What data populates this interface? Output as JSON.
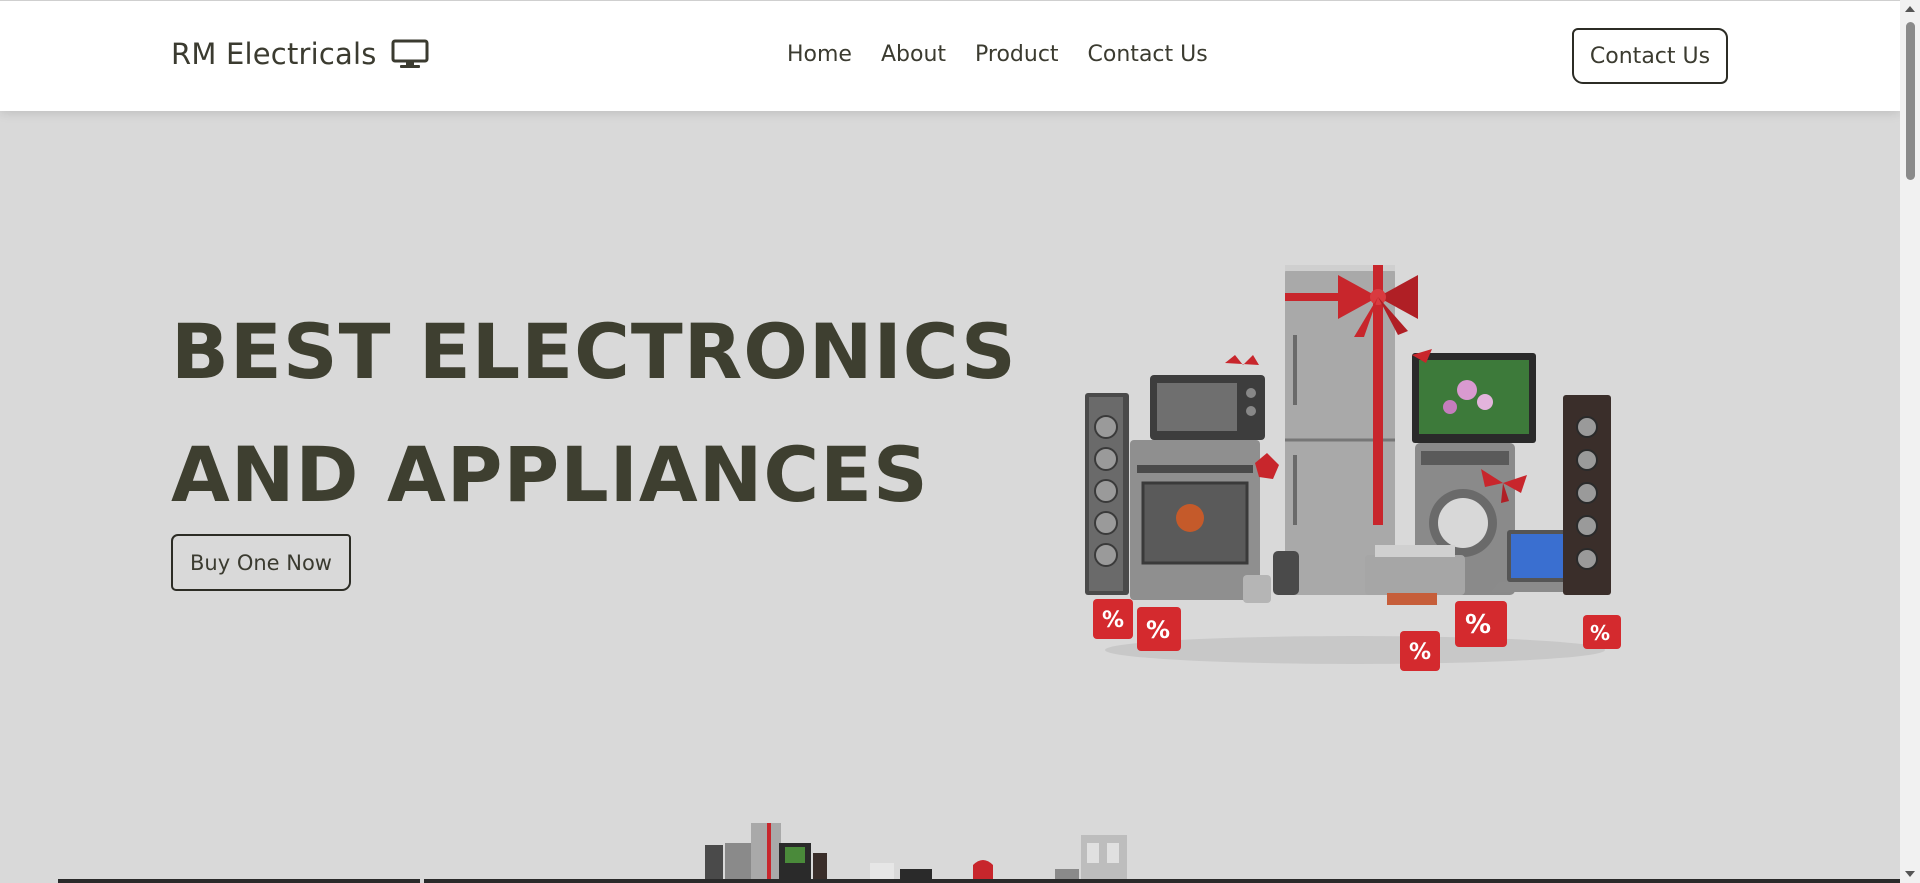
{
  "header": {
    "brand": "RM Electricals",
    "brand_icon": "monitor-icon",
    "nav": [
      "Home",
      "About",
      "Product",
      "Contact Us"
    ],
    "cta_label": "Contact Us"
  },
  "hero": {
    "headline_line1": "BEST ELECTRONICS",
    "headline_line2": "AND APPLIANCES",
    "cta_label": "Buy One Now",
    "image": "home-appliances-gift-image",
    "strip_image": "appliances-thumbnail-strip"
  },
  "colors": {
    "background": "#d9d9d9",
    "header_bg": "#ffffff",
    "text": "#3e3f30",
    "accent_red": "#c8262c"
  }
}
